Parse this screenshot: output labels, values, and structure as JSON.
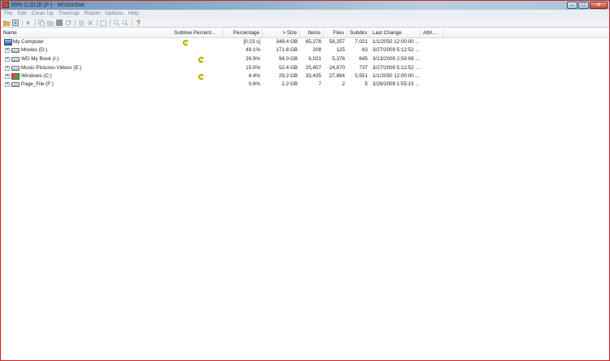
{
  "window": {
    "title": "69% C:|D:|E:|F:| - WinDirStat",
    "buttons": [
      "–",
      "□",
      "✕"
    ]
  },
  "menu": [
    "File",
    "Edit",
    "Clean Up",
    "Treemap",
    "Report",
    "Options",
    "Help"
  ],
  "toolbar": {
    "icons": [
      "open-folder-icon",
      "refresh-icon",
      "play-icon",
      "copy-path-icon",
      "explorer-icon",
      "command-prompt-icon",
      "refresh-selected-icon",
      "recycle-icon",
      "delete-icon",
      "new-folder-icon",
      "zoom-in-icon",
      "zoom-out-icon",
      "help-icon"
    ]
  },
  "columns": [
    "Name",
    "Subtree Percent...",
    "Percentage",
    "> Size",
    "Items",
    "Files",
    "Subdirs",
    "Last Change",
    "Attri..."
  ],
  "rows": [
    {
      "name": "My Computer",
      "icon": "computer-icon",
      "expander": "",
      "pacman": true,
      "percentage": "[0:23 s]",
      "size": "349.4 GB",
      "items": "65,278",
      "files": "58,257",
      "subdirs": "7,021",
      "last_change": "1/1/2050  12:00:00 ..."
    },
    {
      "name": "Movies (D:)",
      "icon": "drive-icon",
      "expander": "+",
      "pacman": false,
      "percentage": "49.1%",
      "size": "171.6 GB",
      "items": "208",
      "files": "125",
      "subdirs": "83",
      "last_change": "3/27/2009  5:12:52 ..."
    },
    {
      "name": "WD My Book (I:)",
      "icon": "drive-icon",
      "expander": "+",
      "pacman": true,
      "percentage": "26.9%",
      "size": "94.0 GB",
      "items": "6,021",
      "files": "5,376",
      "subdirs": "645",
      "last_change": "3/13/2009  2:59:09 ..."
    },
    {
      "name": "Music-Pictures-Videos (E:)",
      "icon": "drive-icon",
      "expander": "+",
      "pacman": false,
      "percentage": "15.0%",
      "size": "52.4 GB",
      "items": "25,607",
      "files": "24,870",
      "subdirs": "737",
      "last_change": "3/27/2009  5:12:52 ..."
    },
    {
      "name": "Windows (C:)",
      "icon": "windows-drive-icon",
      "expander": "+",
      "pacman": true,
      "percentage": "8.4%",
      "size": "29.2 GB",
      "items": "33,435",
      "files": "27,884",
      "subdirs": "5,551",
      "last_change": "1/1/2050  12:00:00 ..."
    },
    {
      "name": "Page_File (F:)",
      "icon": "drive-icon",
      "expander": "+",
      "pacman": false,
      "percentage": "0.6%",
      "size": "2.2 GB",
      "items": "7",
      "files": "2",
      "subdirs": "5",
      "last_change": "3/28/2009  1:55:15 ..."
    }
  ],
  "colors": {
    "frame_border": "#d42020",
    "titlebar": "#8fb1cb",
    "pacman": "#f2e61b"
  }
}
